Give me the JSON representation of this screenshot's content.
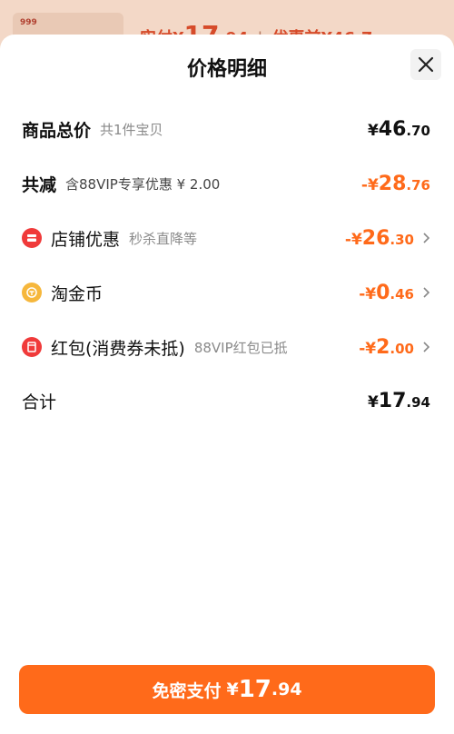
{
  "background_page": {
    "logo_text": "999",
    "paid_label": "实付",
    "paid_currency": "¥",
    "paid_int": "17",
    "paid_dec": ".94",
    "before_label": "优惠前",
    "before_value": "¥46.7"
  },
  "sheet": {
    "title": "价格明细",
    "close_icon": "close-icon"
  },
  "rows": [
    {
      "label": "商品总价",
      "sub": "共1件宝贝",
      "currency": "¥",
      "int": "46",
      "dec": ".70"
    },
    {
      "label": "共减",
      "sub": "含88VIP专享优惠 ¥ 2.00",
      "currency": "-¥",
      "int": "28",
      "dec": ".76"
    },
    {
      "label": "店铺优惠",
      "sub": "秒杀直降等",
      "currency": "-¥",
      "int": "26",
      "dec": ".30",
      "icon": "store-icon"
    },
    {
      "label": "淘金币",
      "sub": "",
      "currency": "-¥",
      "int": "0",
      "dec": ".46",
      "icon": "coin-icon"
    },
    {
      "label": "红包(消费券未抵)",
      "sub": "88VIP红包已抵",
      "currency": "-¥",
      "int": "2",
      "dec": ".00",
      "icon": "red-packet-icon"
    },
    {
      "label": "合计",
      "sub": "",
      "currency": "¥",
      "int": "17",
      "dec": ".94"
    }
  ],
  "pay_button": {
    "label": "免密支付",
    "currency": "¥",
    "int": "17",
    "dec": ".94"
  },
  "colors": {
    "accent": "#ff6a1a",
    "icon_red": "#f03a3a",
    "icon_gold": "#f6b73c"
  }
}
